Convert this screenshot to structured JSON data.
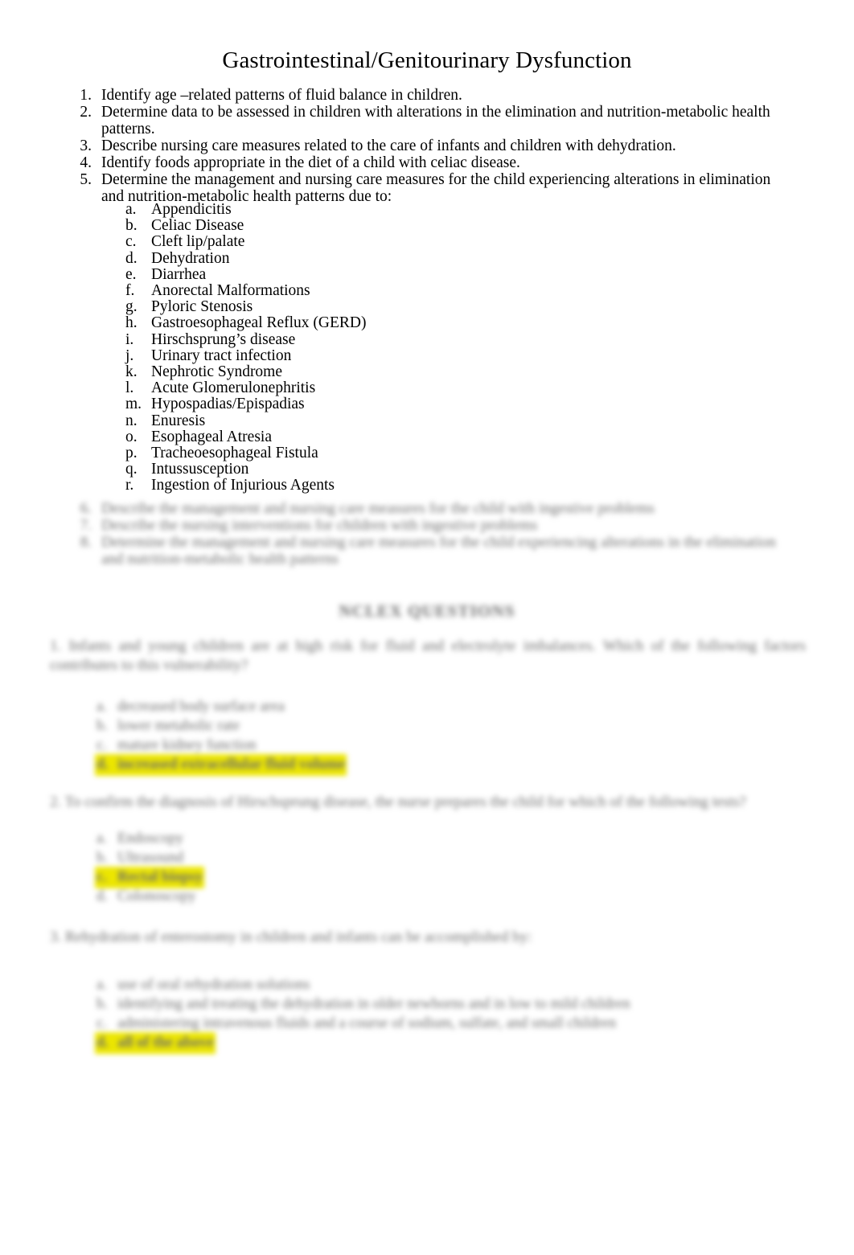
{
  "document": {
    "title": "Gastrointestinal/Genitourinary Dysfunction",
    "background_color": "#ffffff",
    "text_color": "#000000",
    "highlight_color": "#ECE600"
  },
  "objectives": [
    {
      "number": "1.",
      "text": "Identify age –related patterns of fluid balance in children."
    },
    {
      "number": "2.",
      "text": "Determine data to be assessed in children with alterations in the elimination and nutrition-metabolic health patterns."
    },
    {
      "number": "3.",
      "text": "Describe nursing care measures related to the care of infants and children with dehydration."
    },
    {
      "number": "4.",
      "text": "Identify foods appropriate in the diet of a child with celiac disease."
    },
    {
      "number": "5.",
      "text": "Determine the management and nursing care measures for the child experiencing alterations in elimination and nutrition-metabolic health patterns due to:"
    }
  ],
  "sublist": [
    {
      "letter": "a.",
      "text": "Appendicitis"
    },
    {
      "letter": "b.",
      "text": "Celiac Disease"
    },
    {
      "letter": "c.",
      "text": "Cleft lip/palate"
    },
    {
      "letter": "d.",
      "text": "Dehydration"
    },
    {
      "letter": "e.",
      "text": "Diarrhea"
    },
    {
      "letter": "f.",
      "text": "Anorectal Malformations"
    },
    {
      "letter": "g.",
      "text": "Pyloric Stenosis"
    },
    {
      "letter": "h.",
      "text": "Gastroesophageal Reflux (GERD)"
    },
    {
      "letter": "i.",
      "text": "Hirschsprung’s disease"
    },
    {
      "letter": "j.",
      "text": "Urinary tract infection"
    },
    {
      "letter": "k.",
      "text": "Nephrotic Syndrome"
    },
    {
      "letter": "l.",
      "text": "Acute Glomerulonephritis"
    },
    {
      "letter": "m.",
      "text": "Hypospadias/Epispadias"
    },
    {
      "letter": "n.",
      "text": "Enuresis"
    },
    {
      "letter": "o.",
      "text": "Esophageal Atresia"
    },
    {
      "letter": "p.",
      "text": "Tracheoesophageal Fistula"
    },
    {
      "letter": "q.",
      "text": "Intussusception"
    },
    {
      "letter": "r.",
      "text": "Ingestion of Injurious Agents"
    }
  ],
  "objectives_tail": [
    {
      "number": "6.",
      "text": "Describe the management and nursing care measures for the child with ingestive problems"
    },
    {
      "number": "7.",
      "text": "Describe the nursing interventions for children with ingestive problems"
    },
    {
      "number": "8.",
      "text": "Determine the management and nursing care measures for the child experiencing alterations in the elimination and nutrition-metabolic health patterns"
    }
  ],
  "nclex": {
    "header": "NCLEX QUESTIONS",
    "questions": [
      {
        "number": "1.",
        "stem": "Infants and young children are at high risk for fluid and electrolyte imbalances.  Which of the following factors contributes to this vulnerability?",
        "options": [
          {
            "letter": "a.",
            "text": "decreased body surface area",
            "highlighted": false
          },
          {
            "letter": "b.",
            "text": "lower metabolic rate",
            "highlighted": false
          },
          {
            "letter": "c.",
            "text": "mature kidney function",
            "highlighted": false
          },
          {
            "letter": "d.",
            "text": "increased extracellular fluid volume",
            "highlighted": true
          }
        ]
      },
      {
        "number": "2.",
        "stem": "To confirm the diagnosis of Hirschsprung disease, the nurse prepares the child for which of the following tests?",
        "options": [
          {
            "letter": "a.",
            "text": "Endoscopy",
            "highlighted": false
          },
          {
            "letter": "b.",
            "text": "Ultrasound",
            "highlighted": false
          },
          {
            "letter": "c.",
            "text": "Rectal biopsy",
            "highlighted": true
          },
          {
            "letter": "d.",
            "text": "Colonoscopy",
            "highlighted": false
          }
        ]
      },
      {
        "number": "3.",
        "stem": "Rehydration of enterostomy in children and infants can be accomplished by:",
        "options": [
          {
            "letter": "a.",
            "text": "use of oral rehydration solutions",
            "highlighted": false
          },
          {
            "letter": "b.",
            "text": "identifying and treating the dehydration in older newborns and in low to mild children",
            "highlighted": false
          },
          {
            "letter": "c.",
            "text": "administering intravenous fluids and a course of sodium, sulfate, and small children",
            "highlighted": false
          },
          {
            "letter": "d.",
            "text": "all of the above",
            "highlighted": true
          }
        ]
      }
    ]
  }
}
